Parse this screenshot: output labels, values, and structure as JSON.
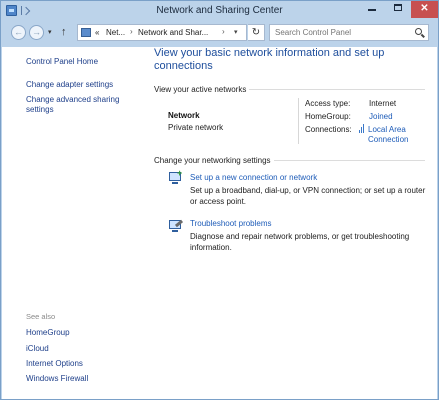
{
  "window": {
    "title": "Network and Sharing Center"
  },
  "nav": {
    "back_glyph": "←",
    "forward_glyph": "→",
    "dropdown_glyph": "▾",
    "up_glyph": "↑",
    "refresh_glyph": "↻",
    "address": {
      "prefix": "«",
      "crumb1": "Net...",
      "crumb2": "Network and Shar...",
      "chevron": "›",
      "dropdown": "▾"
    },
    "search_placeholder": "Search Control Panel"
  },
  "sidebar": {
    "home_link": "Control Panel Home",
    "links": [
      "Change adapter settings",
      "Change advanced sharing settings"
    ],
    "see_also_label": "See also",
    "see_also": [
      "HomeGroup",
      "iCloud",
      "Internet Options",
      "Windows Firewall"
    ]
  },
  "main": {
    "title": "View your basic network information and set up connections",
    "active_networks_heading": "View your active networks",
    "network": {
      "name": "Network",
      "type": "Private network",
      "access_type_label": "Access type:",
      "access_type_value": "Internet",
      "homegroup_label": "HomeGroup:",
      "homegroup_value": "Joined",
      "connections_label": "Connections:",
      "connections_value": "Local Area Connection"
    },
    "change_settings_heading": "Change your networking settings",
    "tasks": [
      {
        "title": "Set up a new connection or network",
        "description": "Set up a broadband, dial-up, or VPN connection; or set up a router or access point.",
        "icon": "new-connection-icon"
      },
      {
        "title": "Troubleshoot problems",
        "description": "Diagnose and repair network problems, or get troubleshooting information.",
        "icon": "troubleshoot-icon"
      }
    ]
  },
  "colors": {
    "chrome": "#bcd3ea",
    "link": "#1e5cb8",
    "title": "#1e4e9c",
    "close": "#c75050"
  }
}
